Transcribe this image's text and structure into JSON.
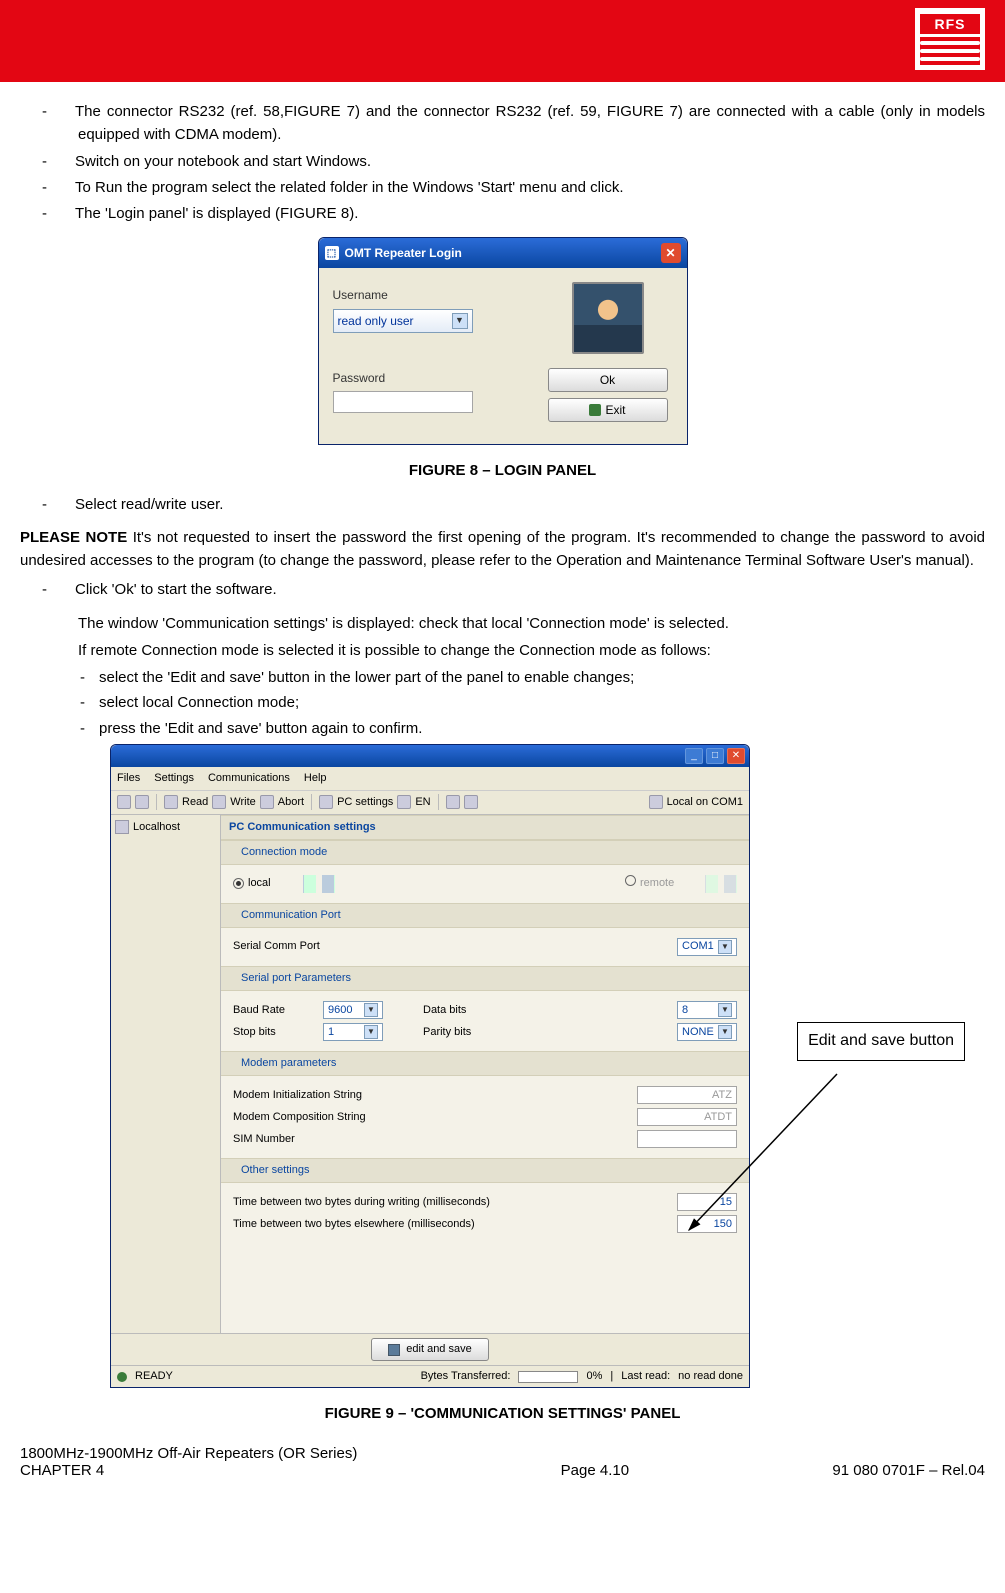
{
  "logo": {
    "text": "RFS"
  },
  "bullets_top": [
    "The connector RS232 (ref. 58,FIGURE 7) and the connector RS232 (ref. 59, FIGURE 7) are connected with a cable (only in models equipped with CDMA modem).",
    "Switch on your notebook and start Windows.",
    "To Run the program select the related folder in the Windows 'Start' menu and click.",
    "The 'Login panel' is displayed (FIGURE 8)."
  ],
  "figure8": {
    "window_title": "OMT Repeater Login",
    "username_label": "Username",
    "username_value": "read only user",
    "password_label": "Password",
    "ok_label": "Ok",
    "exit_label": "Exit",
    "caption": "FIGURE 8 – LOGIN PANEL"
  },
  "bullets_mid1": [
    "Select read/write user."
  ],
  "note": {
    "label": "PLEASE NOTE",
    "text": " It's not requested to insert the password the first opening of the program. It's recommended to change the password to avoid undesired accesses to the program (to change the password, please refer to the Operation and Maintenance Terminal Software User's manual)."
  },
  "bullets_mid2": [
    "Click 'Ok' to start the software."
  ],
  "cont_lines": [
    "The window 'Communication settings' is displayed: check that local 'Connection mode' is selected.",
    "If remote Connection mode is selected it is possible to change the Connection mode as follows:"
  ],
  "sub_bullets": [
    "select the 'Edit and save' button in the lower part of the panel to enable changes;",
    "select local Connection mode;",
    "press the 'Edit and save' button again to confirm."
  ],
  "figure9": {
    "menu": [
      "Files",
      "Settings",
      "Communications",
      "Help"
    ],
    "toolbar": {
      "read": "Read",
      "write": "Write",
      "abort": "Abort",
      "pcset": "PC settings",
      "en": "EN",
      "right": "Local on COM1"
    },
    "tree_root": "Localhost",
    "section_pc": "PC Communication settings",
    "conn_mode_hdr": "Connection mode",
    "conn_local": "local",
    "conn_remote": "remote",
    "comm_port_hdr": "Communication Port",
    "serial_port_lbl": "Serial Comm Port",
    "serial_port_val": "COM1",
    "serial_params_hdr": "Serial port Parameters",
    "baud_lbl": "Baud Rate",
    "baud_val": "9600",
    "stop_lbl": "Stop bits",
    "stop_val": "1",
    "data_lbl": "Data bits",
    "data_val": "8",
    "parity_lbl": "Parity bits",
    "parity_val": "NONE",
    "modem_hdr": "Modem parameters",
    "modem_init_lbl": "Modem Initialization String",
    "modem_init_val": "ATZ",
    "modem_comp_lbl": "Modem Composition String",
    "modem_comp_val": "ATDT",
    "sim_lbl": "SIM Number",
    "other_hdr": "Other settings",
    "other1_lbl": "Time between two bytes during writing (milliseconds)",
    "other1_val": "15",
    "other2_lbl": "Time between two bytes elsewhere (milliseconds)",
    "other2_val": "150",
    "edit_save": "edit and save",
    "status_ready": "READY",
    "status_bytes": "Bytes Transferred:",
    "status_pct": "0%",
    "status_lastread_lbl": "Last read:",
    "status_lastread_val": "no read done",
    "caption": "FIGURE 9 – 'COMMUNICATION SETTINGS' PANEL",
    "callout": "Edit and save button"
  },
  "footer": {
    "left1": "1800MHz-1900MHz Off-Air Repeaters (OR Series)",
    "left2": "CHAPTER 4",
    "mid": "Page 4.10",
    "right": "91 080 0701F – Rel.04"
  }
}
